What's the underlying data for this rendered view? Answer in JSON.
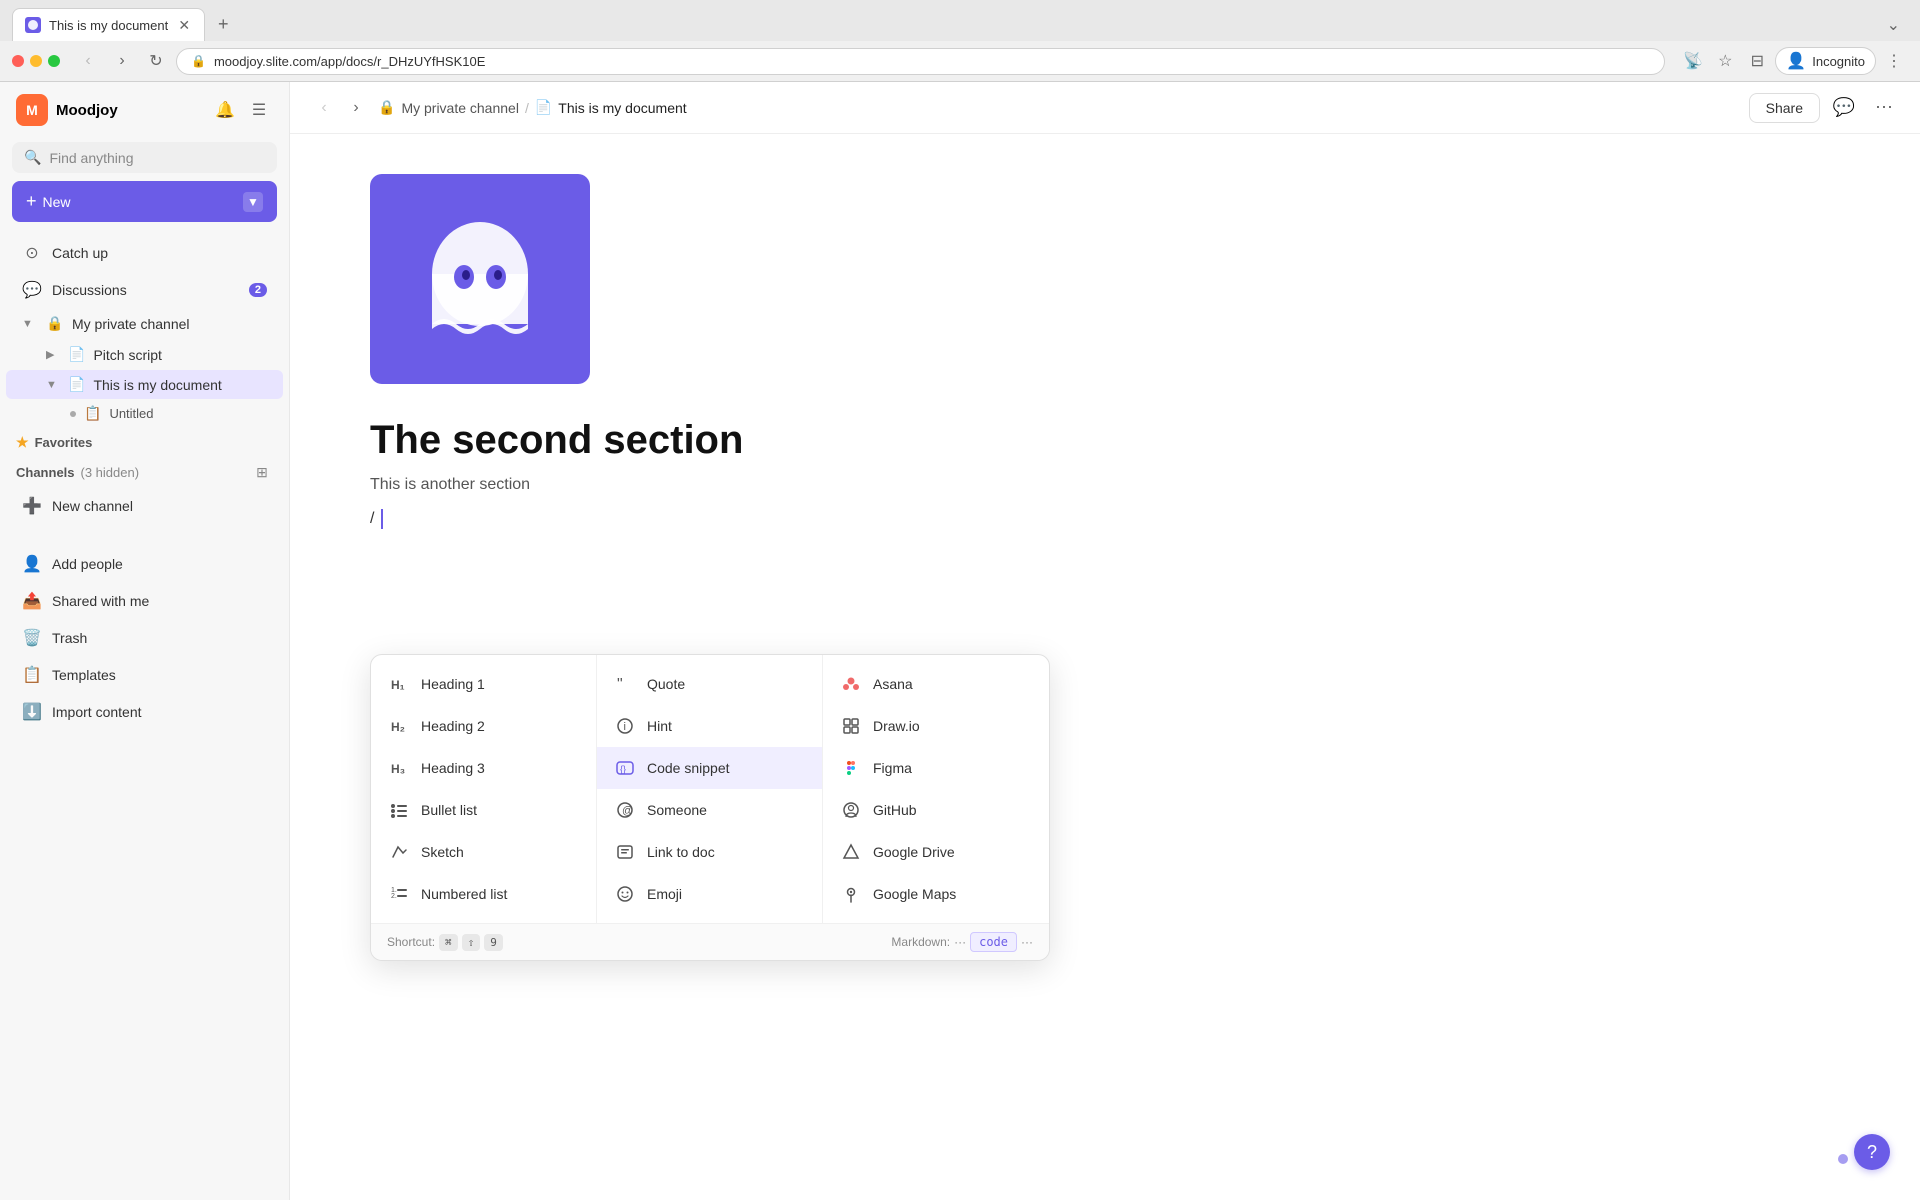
{
  "browser": {
    "tab_title": "This is my document",
    "url": "moodjoy.slite.com/app/docs/r_DHzUYfHSK10E",
    "profile_label": "Incognito"
  },
  "sidebar": {
    "workspace_name": "Moodjoy",
    "workspace_initial": "M",
    "search_placeholder": "Find anything",
    "new_button_label": "New",
    "nav_items": [
      {
        "id": "catch-up",
        "label": "Catch up",
        "icon": "🔄"
      },
      {
        "id": "discussions",
        "label": "Discussions",
        "icon": "💬",
        "badge": "2"
      }
    ],
    "my_private_channel": {
      "label": "My private channel",
      "docs": [
        {
          "id": "pitch-script",
          "label": "Pitch script"
        },
        {
          "id": "this-is-my-document",
          "label": "This is my document",
          "active": true,
          "subdocs": [
            {
              "id": "untitled",
              "label": "Untitled"
            }
          ]
        }
      ]
    },
    "favorites": {
      "label": "Favorites"
    },
    "channels": {
      "label": "Channels",
      "hidden_count": "3 hidden"
    },
    "footer_items": [
      {
        "id": "new-channel",
        "label": "New channel",
        "icon": "➕"
      },
      {
        "id": "add-people",
        "label": "Add people",
        "icon": "👤"
      },
      {
        "id": "shared-with-me",
        "label": "Shared with me",
        "icon": "📤"
      },
      {
        "id": "trash",
        "label": "Trash",
        "icon": "🗑️"
      },
      {
        "id": "templates",
        "label": "Templates",
        "icon": "📋"
      },
      {
        "id": "import-content",
        "label": "Import content",
        "icon": "⬇️"
      }
    ]
  },
  "topbar": {
    "breadcrumb_channel": "My private channel",
    "breadcrumb_doc": "This is my document",
    "share_label": "Share"
  },
  "document": {
    "section_title": "The second section",
    "section_text": "This is another section",
    "cursor_text": "/"
  },
  "slash_menu": {
    "columns": [
      {
        "items": [
          {
            "id": "heading1",
            "label": "Heading 1",
            "icon": "H₁"
          },
          {
            "id": "heading2",
            "label": "Heading 2",
            "icon": "H₂"
          },
          {
            "id": "heading3",
            "label": "Heading 3",
            "icon": "H₃"
          },
          {
            "id": "bullet-list",
            "label": "Bullet list",
            "icon": "≡"
          },
          {
            "id": "sketch",
            "label": "Sketch",
            "icon": "✏️"
          },
          {
            "id": "numbered-list",
            "label": "Numbered list",
            "icon": "1≡"
          }
        ]
      },
      {
        "items": [
          {
            "id": "quote",
            "label": "Quote",
            "icon": "❝"
          },
          {
            "id": "hint",
            "label": "Hint",
            "icon": "ℹ️"
          },
          {
            "id": "code-snippet",
            "label": "Code snippet",
            "icon": "{}",
            "highlighted": true
          },
          {
            "id": "someone",
            "label": "Someone",
            "icon": "@"
          },
          {
            "id": "link-to-doc",
            "label": "Link to doc",
            "icon": "📄"
          },
          {
            "id": "emoji",
            "label": "Emoji",
            "icon": "😊"
          }
        ]
      },
      {
        "items": [
          {
            "id": "asana",
            "label": "Asana",
            "icon": "⬡"
          },
          {
            "id": "drawio",
            "label": "Draw.io",
            "icon": "◫"
          },
          {
            "id": "figma",
            "label": "Figma",
            "icon": "◈"
          },
          {
            "id": "github",
            "label": "GitHub",
            "icon": "⊙"
          },
          {
            "id": "google-drive",
            "label": "Google Drive",
            "icon": "△"
          },
          {
            "id": "google-maps",
            "label": "Google Maps",
            "icon": "📍"
          }
        ]
      }
    ],
    "shortcut_label": "Shortcut:",
    "shortcut_keys": [
      "⌘",
      "⇧",
      "9"
    ],
    "markdown_label": "Markdown:",
    "markdown_code": "code",
    "markdown_ticks": "···",
    "markdown_ticks_end": "···"
  }
}
